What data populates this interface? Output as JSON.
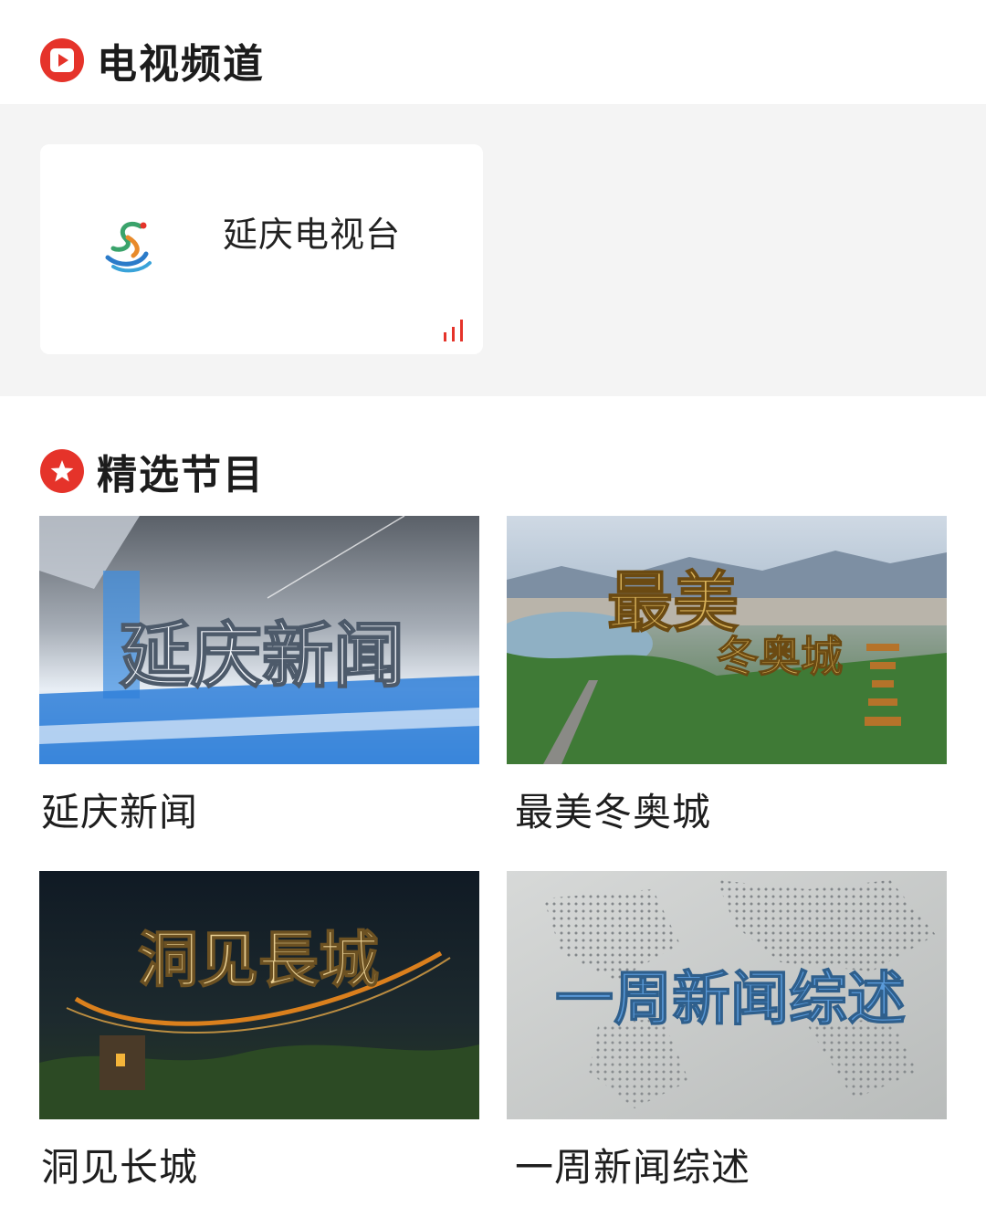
{
  "tv_section": {
    "title": "电视频道",
    "icon": "play-icon"
  },
  "channel": {
    "name": "延庆电视台",
    "logo": "yanqing-tv-logo",
    "live_indicator_icon": "audio-bars-icon"
  },
  "programs_section": {
    "title": "精选节目",
    "icon": "star-icon"
  },
  "programs": [
    {
      "caption": "延庆新闻",
      "thumb_text": "延庆新闻"
    },
    {
      "caption": "最美冬奥城",
      "thumb_text_top": "最美",
      "thumb_text_bottom": "冬奥城"
    },
    {
      "caption": "洞见长城",
      "thumb_text": "洞见長城"
    },
    {
      "caption": "一周新闻综述",
      "thumb_text": "一周新闻综述"
    }
  ],
  "colors": {
    "accent": "#e5332a",
    "band": "#f4f4f4"
  }
}
